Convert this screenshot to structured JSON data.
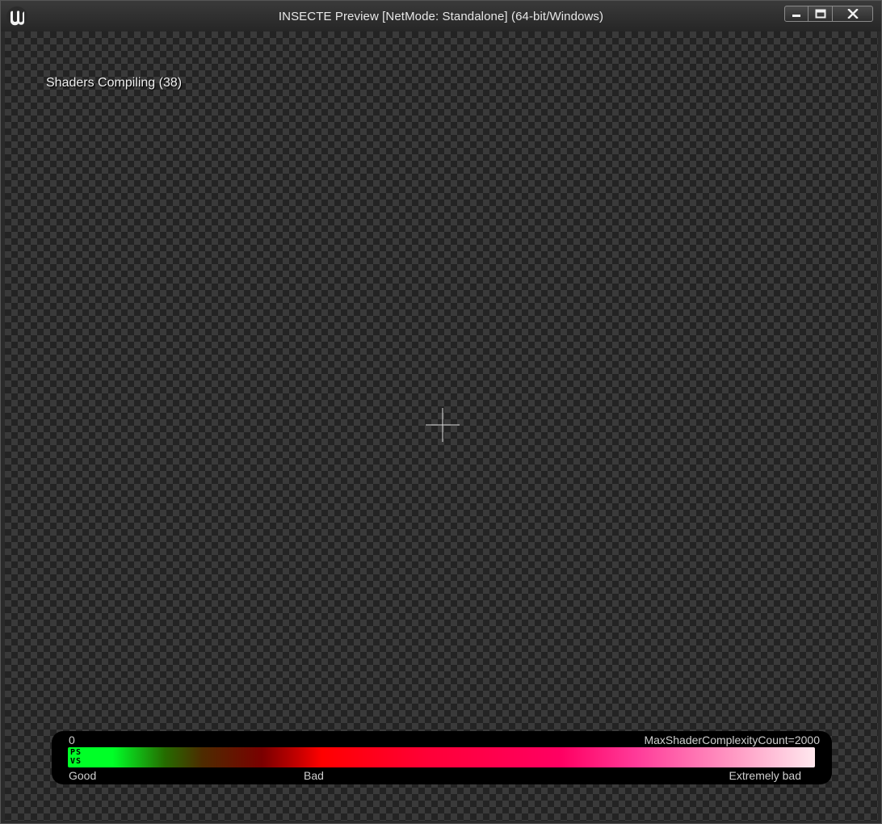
{
  "window": {
    "title": "INSECTE Preview [NetMode: Standalone]  (64-bit/Windows)",
    "logo_icon": "unreal-engine-logo",
    "controls": {
      "minimize_icon": "minimize-icon",
      "maximize_icon": "maximize-icon",
      "close_icon": "close-icon"
    }
  },
  "viewport": {
    "status_text": "Shaders Compiling (38)",
    "background": "checkerboard",
    "crosshair_icon": "crosshair-icon"
  },
  "shader_complexity": {
    "min_label": "0",
    "max_label": "MaxShaderComplexityCount=2000",
    "ps_label": "PS",
    "vs_label": "VS",
    "legend": {
      "good": "Good",
      "bad": "Bad",
      "extremely_bad": "Extremely bad"
    },
    "colors": {
      "good": "#00ff27",
      "bad": "#ff0000",
      "extremely_bad": "#ffe8ee"
    }
  }
}
